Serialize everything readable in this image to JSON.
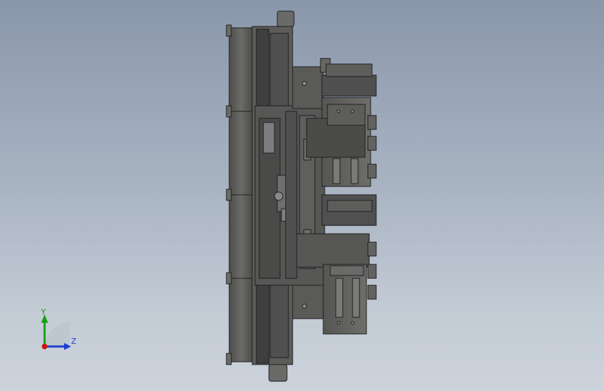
{
  "app": {
    "view": "cad-3d-viewport",
    "background_top": "#8a97aa",
    "background_bottom": "#ccd3db"
  },
  "model": {
    "kind": "mechanical-assembly",
    "orientation": "side-view",
    "body_color": "#5a5a58",
    "edge_color": "#1e1e1e"
  },
  "triad": {
    "y_label": "Y",
    "z_label": "Z",
    "y_color": "#14a014",
    "z_color": "#1d3fd0",
    "x_color": "#c81414"
  }
}
